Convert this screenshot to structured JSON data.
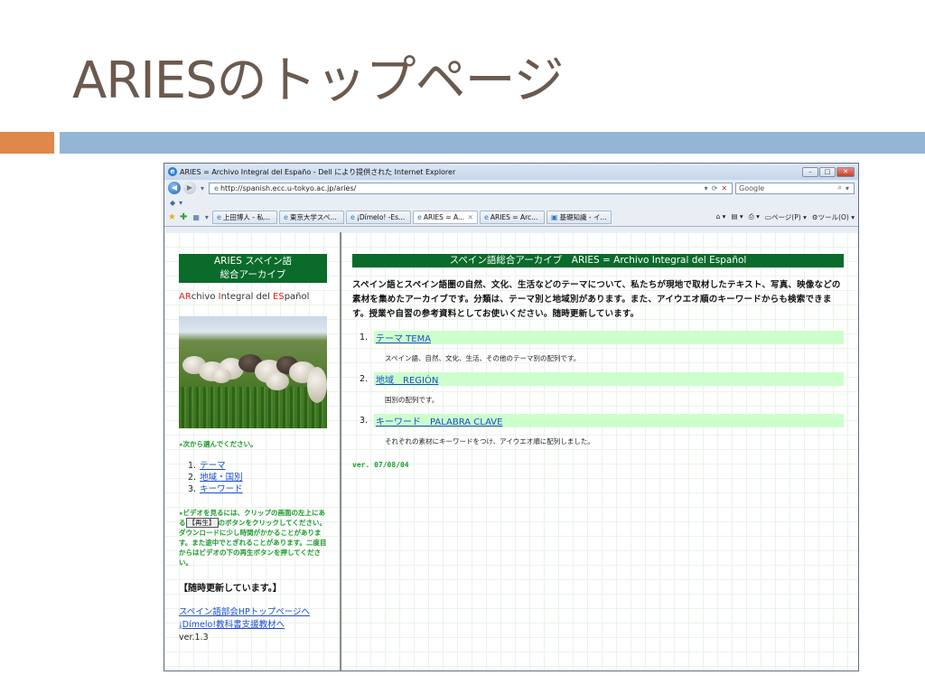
{
  "slide": {
    "title": "ARIESのトップページ",
    "accent_orange": "#e0874a",
    "accent_blue": "#94b5d6"
  },
  "browser": {
    "window_title": "ARIES = Archivo Integral del Españo - Dell により提供された Internet Explorer",
    "url": "http://spanish.ecc.u-tokyo.ac.jp/aries/",
    "search_placeholder": "Google",
    "tabs": [
      {
        "label": "上田博人 - 私..."
      },
      {
        "label": "東京大学スペ..."
      },
      {
        "label": "¡Dímelo! -Es..."
      },
      {
        "label": "ARIES = A...",
        "active": true
      },
      {
        "label": "ARIES = Arc..."
      },
      {
        "label": "基礎知識 - イ..."
      }
    ],
    "page_menu": "ページ(P)",
    "tools_menu": "ツール(O)"
  },
  "sidebar": {
    "header_line1": "ARIES スペイン語",
    "header_line2": "総合アーカイブ",
    "archivo": {
      "p1": "AR",
      "p2": "chivo ",
      "p3": "I",
      "p4": "ntegral del ",
      "p5": "ES",
      "p6": "pañol"
    },
    "choose_text": "★次から選んでください。",
    "nav": [
      {
        "num": "1.",
        "label": "テーマ"
      },
      {
        "num": "2.",
        "label": "地域・国別"
      },
      {
        "num": "3.",
        "label": "キーワード"
      }
    ],
    "video_note_a": "★ビデオを見るには、クリップの画面の左上にある",
    "play_button": "【再生】",
    "video_note_b": "のボタンをクリックしてください。ダウンロードに少し時間がかかることがあります。また途中でとぎれることがあります。二度目からはビデオの下の再生ボタンを押してください。",
    "update_notice": "【随時更新しています。】",
    "link_spanish_dept": "スペイン語部会HPトップページへ",
    "link_dimelo": "¡Dímelo!教科書支援教材へ",
    "version": "ver.1.3"
  },
  "main": {
    "header": "スペイン語総合アーカイブ　ARIES = Archivo Integral del Español",
    "intro": "スペイン語とスペイン語圏の自然、文化、生活などのテーマについて、私たちが現地で取材したテキスト、写真、映像などの素材を集めたアーカイブです。分類は、テーマ別と地域別があります。また、アイウエオ順のキーワードからも検索できます。授業や自習の参考資料としてお使いください。随時更新しています。",
    "sections": [
      {
        "num": "1.",
        "title": "テーマ TEMA",
        "desc": "スペイン語、自然、文化、生活、その他のテーマ別の配列です。"
      },
      {
        "num": "2.",
        "title": "地域　REGIÓN",
        "desc": "国別の配列です。"
      },
      {
        "num": "3.",
        "title": "キーワード　PALABRA CLAVE",
        "desc": "それぞれの素材にキーワードをつけ、アイウエオ順に配列しました。"
      }
    ],
    "version": "ver. 07/08/04"
  }
}
